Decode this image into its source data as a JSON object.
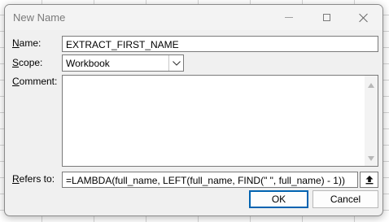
{
  "window": {
    "title": "New Name"
  },
  "form": {
    "name_label_prefix": "",
    "name_label_underlined": "N",
    "name_label_rest": "ame:",
    "name_value": "EXTRACT_FIRST_NAME",
    "scope_label_underlined": "S",
    "scope_label_rest": "cope:",
    "scope_value": "Workbook",
    "comment_label_prefix": "",
    "comment_label_underlined": "C",
    "comment_label_rest": "omment:",
    "comment_value": "",
    "refers_label_underlined": "R",
    "refers_label_rest": "efers to:",
    "refers_value": "=LAMBDA(full_name, LEFT(full_name, FIND(\" \", full_name) - 1))"
  },
  "buttons": {
    "ok_label": "OK",
    "cancel_label": "Cancel"
  },
  "icons": {
    "minimize": "minimize-icon",
    "maximize": "maximize-icon",
    "close": "close-icon",
    "dropdown": "chevron-down-icon",
    "collapse": "collapse-dialog-icon"
  },
  "colors": {
    "ok_border": "#0063b1",
    "dialog_bg": "#f0f0f0"
  }
}
